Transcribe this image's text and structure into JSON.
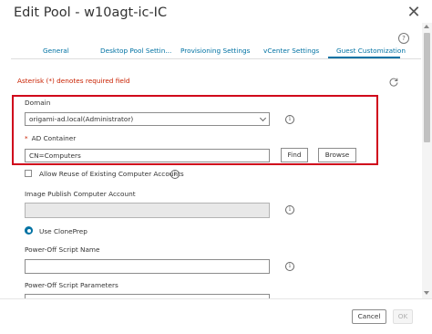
{
  "dialog": {
    "title": "Edit Pool - w10agt-ic-IC",
    "close_icon": "close-icon",
    "help_icon": "help-icon"
  },
  "tabs": [
    {
      "label": "General",
      "active": false
    },
    {
      "label": "Desktop Pool Settin...",
      "active": false
    },
    {
      "label": "Provisioning Settings",
      "active": false
    },
    {
      "label": "vCenter Settings",
      "active": false
    },
    {
      "label": "Guest Customization",
      "active": true
    }
  ],
  "form": {
    "required_note": "Asterisk (*) denotes required field",
    "refresh_icon": "refresh-icon",
    "domain": {
      "label": "Domain",
      "value": "origami-ad.local(Administrator)"
    },
    "ad_container": {
      "required_marker": "*",
      "label": "AD Container",
      "value": "CN=Computers",
      "find_label": "Find",
      "browse_label": "Browse"
    },
    "allow_reuse": {
      "label": "Allow Reuse of Existing Computer Accounts",
      "checked": false
    },
    "image_publish": {
      "label": "Image Publish Computer Account",
      "value": ""
    },
    "clone_prep": {
      "label": "Use ClonePrep",
      "selected": true
    },
    "power_off_script_name": {
      "label": "Power-Off Script Name",
      "value": ""
    },
    "power_off_script_params": {
      "label": "Power-Off Script Parameters",
      "value": ""
    }
  },
  "footer": {
    "cancel_label": "Cancel",
    "ok_label": "OK"
  },
  "colors": {
    "accent": "#0072a3",
    "required": "#c92100",
    "highlight_border": "#d0021b"
  }
}
